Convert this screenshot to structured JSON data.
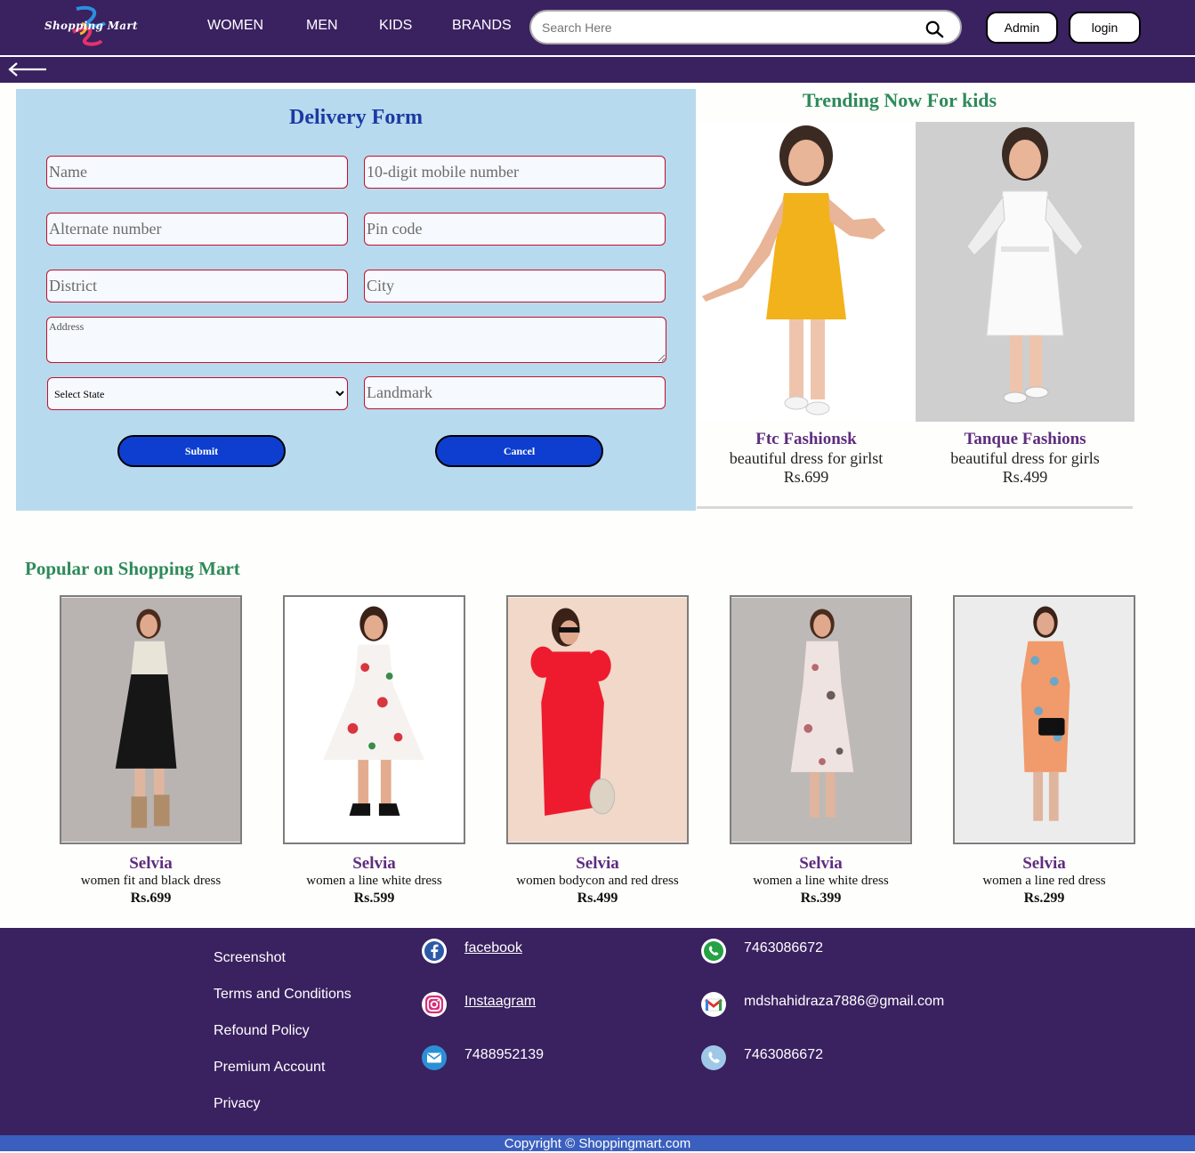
{
  "header": {
    "logo_text": "Shopping Mart",
    "nav": [
      "WOMEN",
      "MEN",
      "KIDS",
      "BRANDS"
    ],
    "search_placeholder": "Search Here",
    "admin_label": "Admin",
    "login_label": "login"
  },
  "form": {
    "title": "Delivery Form",
    "name_placeholder": "Name",
    "mobile_placeholder": "10-digit mobile number",
    "alternate_placeholder": "Alternate number",
    "pincode_placeholder": "Pin code",
    "district_placeholder": "District",
    "city_placeholder": "City",
    "address_placeholder": "Address",
    "state_selected": "Select State",
    "landmark_placeholder": "Landmark",
    "submit_label": "Submit",
    "cancel_label": "Cancel"
  },
  "trending": {
    "title": "Trending Now For kids",
    "items": [
      {
        "brand": "Ftc Fashionsk",
        "desc": "beautiful dress for girlst",
        "price": "Rs.699"
      },
      {
        "brand": "Tanque Fashions",
        "desc": "beautiful dress for girls",
        "price": "Rs.499"
      }
    ]
  },
  "popular": {
    "title": "Popular on Shopping Mart",
    "items": [
      {
        "brand": "Selvia",
        "desc": "women fit and black dress",
        "price": "Rs.699"
      },
      {
        "brand": "Selvia",
        "desc": "women a line white dress",
        "price": "Rs.599"
      },
      {
        "brand": "Selvia",
        "desc": "women bodycon and red dress",
        "price": "Rs.499"
      },
      {
        "brand": "Selvia",
        "desc": "women a line white dress",
        "price": "Rs.399"
      },
      {
        "brand": "Selvia",
        "desc": "women a line red dress",
        "price": "Rs.299"
      }
    ]
  },
  "footer": {
    "links": [
      "Screenshot",
      "Terms and Conditions",
      "Refound Policy",
      "Premium Account",
      "Privacy"
    ],
    "facebook": "facebook",
    "instagram": "Instaagram",
    "mail_phone": "7488952139",
    "whatsapp": "7463086672",
    "gmail": "mdshahidraza7886@gmail.com",
    "phone": "7463086672",
    "copyright": "Copyright © Shoppingmart.com"
  },
  "colors": {
    "header_bg": "#3a2160",
    "form_bg": "#b8daee",
    "button_blue": "#0d3ecf",
    "heading_green": "#2e8a5a",
    "brand_purple": "#5e2d7e",
    "copyright_bar": "#3a5fbe"
  }
}
